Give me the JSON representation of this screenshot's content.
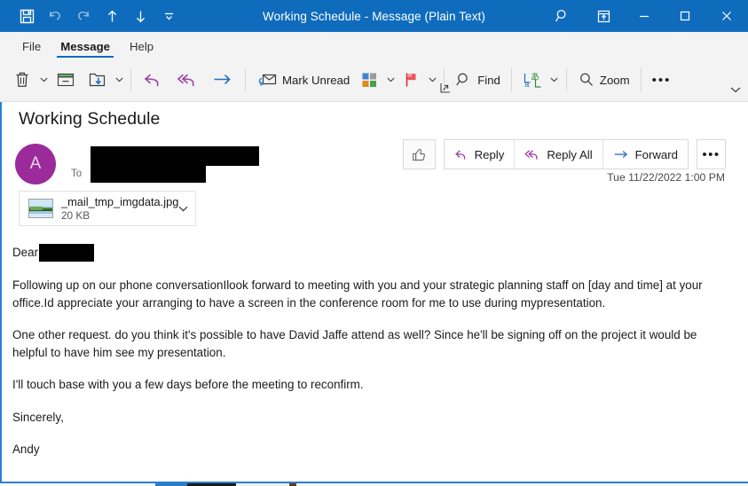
{
  "window": {
    "title": "Working Schedule  -  Message (Plain Text)",
    "accent_color": "#0f6cbd"
  },
  "quick_access": [
    {
      "name": "save",
      "icon": "save-icon",
      "enabled": true
    },
    {
      "name": "undo",
      "icon": "undo-icon",
      "enabled": false
    },
    {
      "name": "redo",
      "icon": "redo-icon",
      "enabled": false
    },
    {
      "name": "previous",
      "icon": "up-arrow-icon",
      "enabled": true
    },
    {
      "name": "next",
      "icon": "down-arrow-icon",
      "enabled": true
    },
    {
      "name": "customize",
      "icon": "customize-qat-icon",
      "enabled": true
    }
  ],
  "titlebar_buttons": [
    {
      "name": "search",
      "icon": "search-icon"
    },
    {
      "name": "ribbon-display-options",
      "icon": "ribbon-options-icon"
    },
    {
      "name": "minimize",
      "icon": "minimize-icon"
    },
    {
      "name": "maximize",
      "icon": "maximize-icon"
    },
    {
      "name": "close",
      "icon": "close-icon"
    }
  ],
  "tabs": [
    {
      "label": "File",
      "active": false
    },
    {
      "label": "Message",
      "active": true
    },
    {
      "label": "Help",
      "active": false
    }
  ],
  "ribbon": {
    "delete_label": "",
    "archive_label": "",
    "move_label": "",
    "reply_label": "",
    "reply_all_label": "",
    "forward_label": "",
    "mark_unread_label": "Mark Unread",
    "categorize_label": "",
    "flag_label": "",
    "find_label": "Find",
    "translate_label": "",
    "zoom_label": "Zoom",
    "more_label": "•••"
  },
  "message": {
    "subject": "Working Schedule",
    "avatar_initial": "A",
    "avatar_color": "#9b2a9b",
    "to_label": "To",
    "sender_redacted": true,
    "recipient_redacted": true,
    "timestamp": "Tue 11/22/2022 1:00 PM"
  },
  "actions": {
    "thumbs_up_label": "",
    "reply_label": "Reply",
    "reply_all_label": "Reply All",
    "forward_label": "Forward",
    "more_label": "•••"
  },
  "attachment": {
    "filename": "_mail_tmp_imgdata.jpg",
    "size": "20 KB"
  },
  "body": {
    "greeting": "Dear",
    "paragraphs": [
      "Following up on our phone conversationIlook forward to meeting with you and your strategic planning staff on [day and time] at your office.Id appreciate your arranging to have a screen in the conference room for me to use during mypresentation.",
      "One other request. do you think it's possible to have David Jaffe attend as well? Since he'll be signing off on the project it would be helpful to have him see my presentation.",
      "I'll touch base with you a few days before the meeting to reconfirm.",
      "Sincerely,",
      "Andy"
    ]
  }
}
